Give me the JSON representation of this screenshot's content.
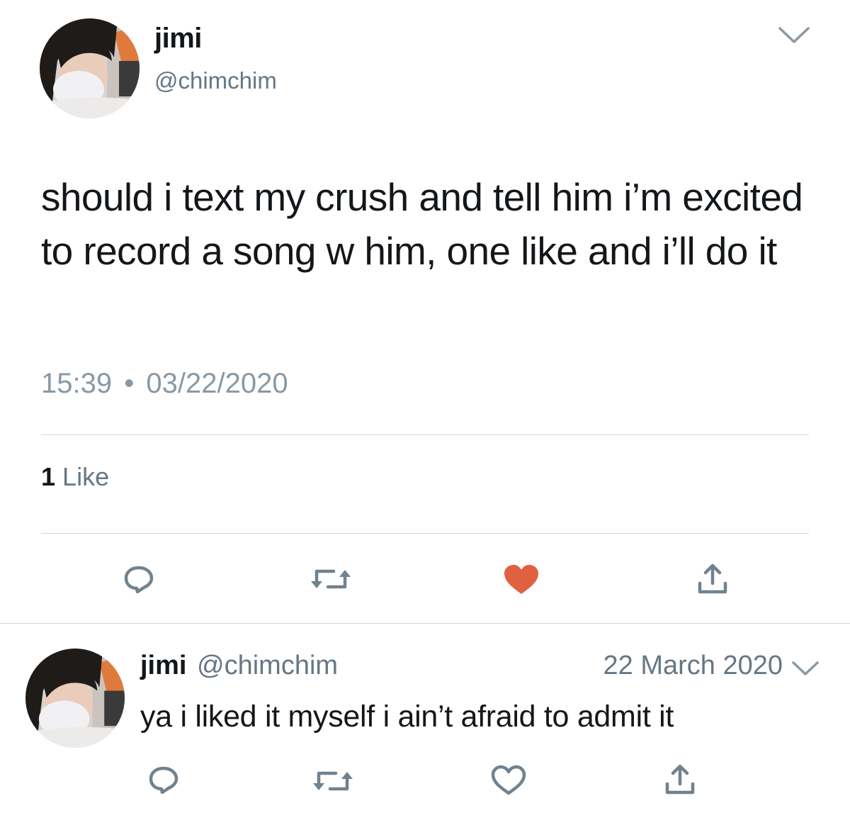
{
  "main_tweet": {
    "author_name": "jimi",
    "author_handle": "@chimchim",
    "avatar_icon": "profile-photo",
    "text": "should i text my crush and tell him i’m excited to record a song w him, one like and i’ll do it",
    "time": "15:39",
    "separator": "•",
    "date": "03/22/2020",
    "likes_count": "1",
    "likes_label": "Like",
    "liked": true,
    "actions": [
      {
        "icon": "reply-icon"
      },
      {
        "icon": "retweet-icon"
      },
      {
        "icon": "heart-filled-icon"
      },
      {
        "icon": "share-icon"
      }
    ]
  },
  "reply": {
    "author_name": "jimi",
    "author_handle": "@chimchim",
    "avatar_icon": "profile-photo",
    "date": "22 March 2020",
    "text": "ya i liked it myself i ain’t afraid to admit it",
    "liked": false,
    "actions": [
      {
        "icon": "reply-icon"
      },
      {
        "icon": "retweet-icon"
      },
      {
        "icon": "heart-outline-icon"
      },
      {
        "icon": "share-icon"
      }
    ]
  },
  "colors": {
    "text": "#14171a",
    "secondary": "#657786",
    "meta": "#8899a6",
    "icon": "#71828f",
    "like_accent": "#e0613f",
    "divider": "#d4d7da"
  }
}
